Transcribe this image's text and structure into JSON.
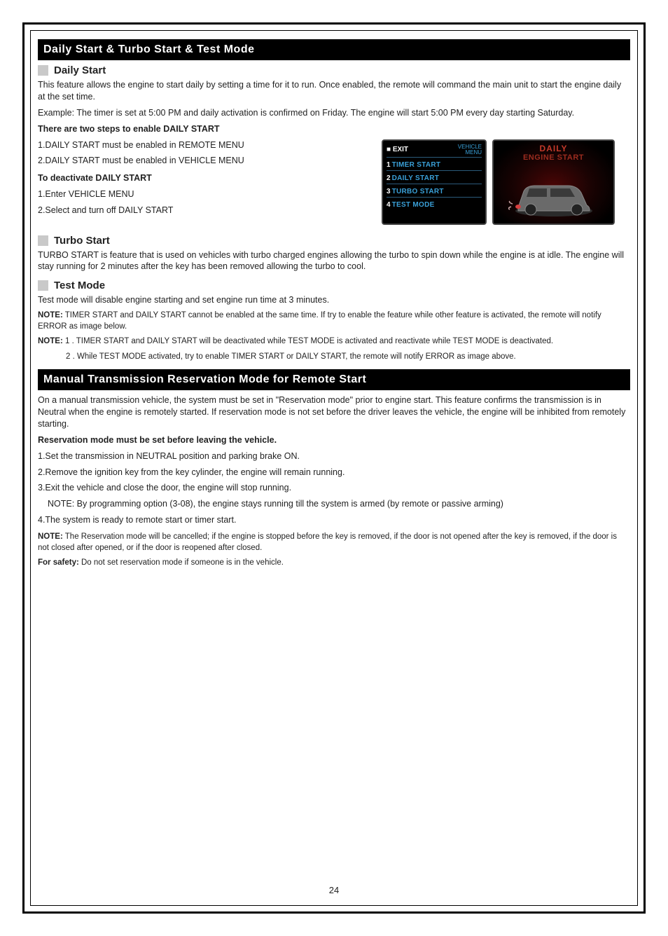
{
  "section1": {
    "bar": "Daily Start & Turbo Start & Test Mode",
    "sub1": {
      "title": "Daily Start"
    },
    "p1": "This feature allows the engine to start daily by setting a time for it to run. Once enabled, the remote will command the main unit to start the engine daily at the set time.",
    "p2": "Example: The timer is set at 5:00 PM and daily activation is confirmed on Friday. The engine will start 5:00 PM every day starting Saturday.",
    "steps_title": "There are two steps to enable DAILY START",
    "s1": "1.DAILY START must be enabled in REMOTE MENU",
    "s2": "2.DAILY START must be enabled in VEHICLE MENU",
    "deact": "To deactivate DAILY START",
    "d1": "1.Enter VEHICLE MENU",
    "d2": "2.Select and turn off DAILY START",
    "sub2": {
      "title": "Turbo Start"
    },
    "tp1": "TURBO START is feature that is used on vehicles with turbo charged engines allowing the turbo to spin down while the engine is at idle. The engine will stay running for 2 minutes after the key has been removed allowing the turbo to cool.",
    "sub3": {
      "title": "Test Mode"
    },
    "tp2": "Test mode will disable engine starting and set engine run time at 3 minutes.",
    "note1_label": "NOTE:",
    "note1_text": "TIMER START and DAILY START cannot be enabled at the same time. If try to enable the feature while other feature is activated, the remote will notify ERROR as image below.",
    "note2_label": "NOTE:",
    "note2_text": "1 . TIMER START and DAILY START will be deactivated while TEST MODE is activated and reactivate while TEST MODE is deactivated.",
    "note3_text": "2 . While TEST MODE activated, try to enable TIMER START or DAILY START, the remote will notify ERROR as image above."
  },
  "menu": {
    "exit": "■ EXIT",
    "header": "VEHICLE\nMENU",
    "r1n": "1",
    "r1t": "TIMER START",
    "r2n": "2",
    "r2t": "DAILY START",
    "r3n": "3",
    "r3t": "TURBO START",
    "r4n": "4",
    "r4t": "TEST MODE"
  },
  "screen2": {
    "t1": "DAILY",
    "t2": "ENGINE START"
  },
  "section2": {
    "bar": "Manual Transmission Reservation Mode for Remote Start",
    "p1": "On a manual transmission vehicle, the system must be set in \"Reservation mode\" prior to engine start. This feature confirms the transmission is in Neutral when the engine is remotely started. If reservation mode is not set before the driver leaves the vehicle, the engine will be inhibited from remotely starting.",
    "p2": "Reservation mode must be set before leaving the vehicle.",
    "s1": "1.Set the transmission in NEUTRAL position and parking brake ON.",
    "s2": "2.Remove the ignition key from the key cylinder, the engine will remain running.",
    "s3a": "3.Exit the vehicle and close the door, the engine will stop running.",
    "s3b": "NOTE: By programming option (3-08), the engine stays running till the system is armed (by remote or passive arming)",
    "s4": "4.The system is ready to remote start or timer start.",
    "note_label": "NOTE:",
    "note_text": "The Reservation mode will be cancelled; if the engine is stopped before the key is removed, if the door is not opened after the key is removed, if the door is not closed after opened, or if the door is reopened after closed.",
    "safety_label": "For safety:",
    "safety_text": "Do not set reservation mode if someone is in the vehicle."
  },
  "page": "24"
}
